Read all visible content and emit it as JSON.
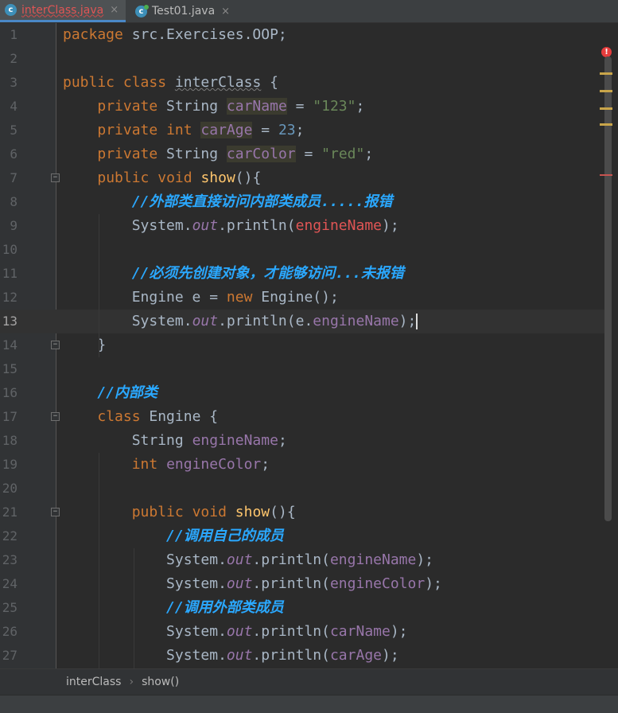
{
  "tabs": [
    {
      "name": "interClass.java",
      "icon": "class-icon",
      "active": true
    },
    {
      "name": "Test01.java",
      "icon": "class-icon",
      "active": false
    }
  ],
  "tab_close_glyph": "×",
  "breadcrumb": {
    "class_name": "interClass",
    "method_name": "show()"
  },
  "current_line": 13,
  "lines": [
    {
      "n": "1",
      "code": "package src.Exercises.OOP;"
    },
    {
      "n": "2",
      "code": ""
    },
    {
      "n": "3",
      "code": "public class interClass {"
    },
    {
      "n": "4",
      "code": "    private String carName = \"123\";"
    },
    {
      "n": "5",
      "code": "    private int carAge = 23;"
    },
    {
      "n": "6",
      "code": "    private String carColor = \"red\";"
    },
    {
      "n": "7",
      "code": "    public void show(){"
    },
    {
      "n": "8",
      "code": "        //外部类直接访问内部类成员.....报错"
    },
    {
      "n": "9",
      "code": "        System.out.println(engineName);"
    },
    {
      "n": "10",
      "code": ""
    },
    {
      "n": "11",
      "code": "        //必须先创建对象，才能够访问...未报错"
    },
    {
      "n": "12",
      "code": "        Engine e = new Engine();"
    },
    {
      "n": "13",
      "code": "        System.out.println(e.engineName);"
    },
    {
      "n": "14",
      "code": "    }"
    },
    {
      "n": "15",
      "code": ""
    },
    {
      "n": "16",
      "code": "    //内部类"
    },
    {
      "n": "17",
      "code": "    class Engine {"
    },
    {
      "n": "18",
      "code": "        String engineName;"
    },
    {
      "n": "19",
      "code": "        int engineColor;"
    },
    {
      "n": "20",
      "code": ""
    },
    {
      "n": "21",
      "code": "        public void show(){"
    },
    {
      "n": "22",
      "code": "            //调用自己的成员"
    },
    {
      "n": "23",
      "code": "            System.out.println(engineName);"
    },
    {
      "n": "24",
      "code": "            System.out.println(engineColor);"
    },
    {
      "n": "25",
      "code": "            //调用外部类成员"
    },
    {
      "n": "26",
      "code": "            System.out.println(carName);"
    },
    {
      "n": "27",
      "code": "            System.out.println(carAge);"
    }
  ],
  "colors": {
    "background": "#2b2b2b",
    "keyword": "#cc7832",
    "string": "#6a8759",
    "number": "#6897bb",
    "field": "#9876aa",
    "method": "#ffc66d",
    "comment": "#2aa8ff",
    "error": "#e05555"
  }
}
